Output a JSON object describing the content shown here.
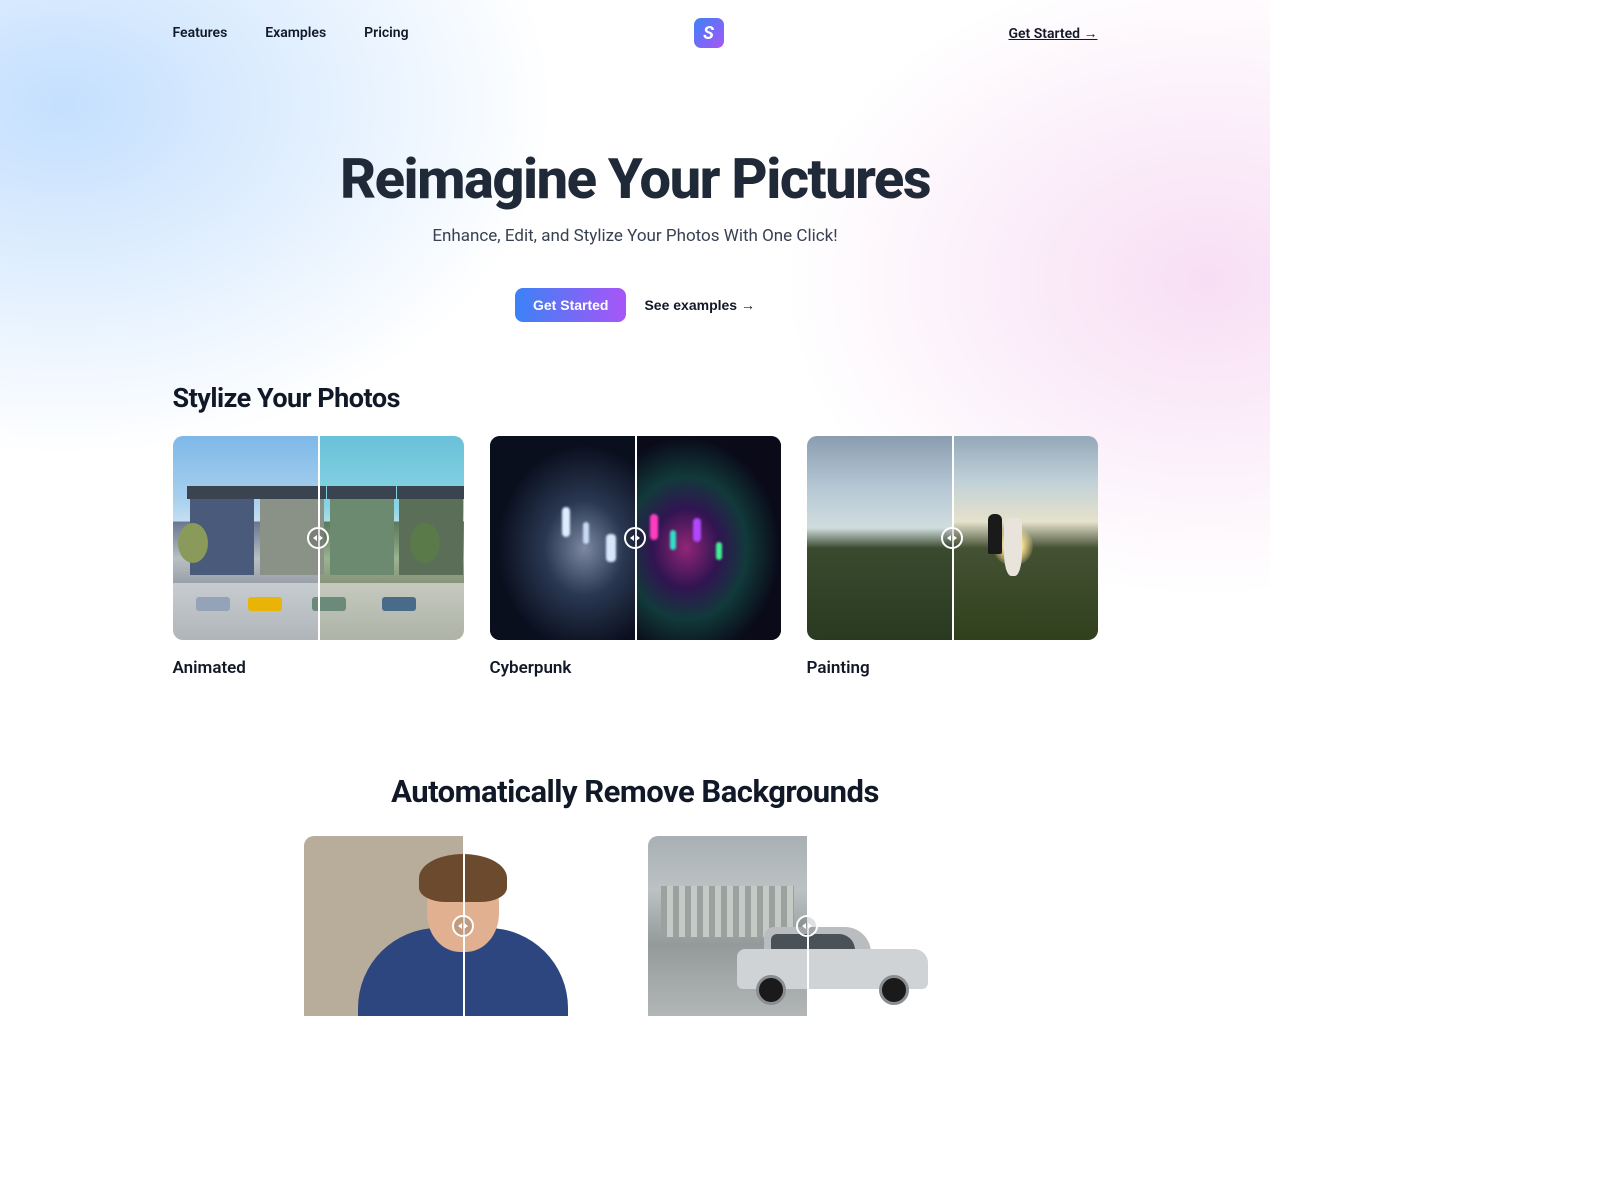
{
  "nav": {
    "features": "Features",
    "examples": "Examples",
    "pricing": "Pricing",
    "logo_letter": "S",
    "cta": "Get Started →"
  },
  "hero": {
    "title": "Reimagine Your Pictures",
    "subtitle": "Enhance, Edit, and Stylize Your Photos With One Click!",
    "primary_btn": "Get Started",
    "secondary_btn": "See examples →"
  },
  "stylize": {
    "title": "Stylize Your Photos",
    "cards": [
      {
        "label": "Animated"
      },
      {
        "label": "Cyberpunk"
      },
      {
        "label": "Painting"
      }
    ]
  },
  "backgrounds": {
    "title": "Automatically Remove Backgrounds"
  }
}
